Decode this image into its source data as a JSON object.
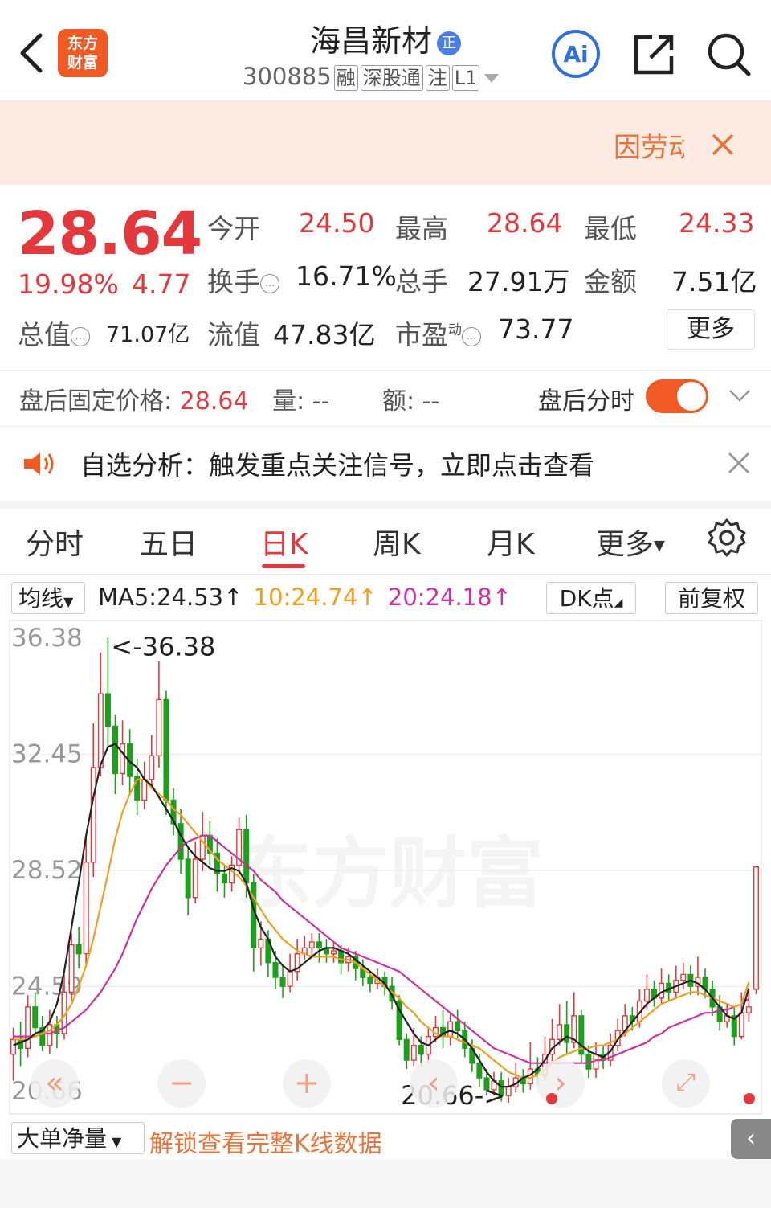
{
  "header": {
    "logo_text": "东方\n财富",
    "stock_name": "海昌新材",
    "name_badge": "正",
    "stock_code": "300885",
    "tags": [
      "融",
      "深股通",
      "注",
      "L1"
    ],
    "ai_label": "Ai"
  },
  "banner": {
    "text": "因劳动"
  },
  "quote": {
    "price": "28.64",
    "change_pct": "19.98%",
    "change": "4.77",
    "fields": [
      {
        "label": "今开",
        "value": "24.50"
      },
      {
        "label": "最高",
        "value": "28.64"
      },
      {
        "label": "最低",
        "value": "24.33"
      },
      {
        "label": "换手",
        "value": "16.71%"
      },
      {
        "label": "总手",
        "value": "27.91万"
      },
      {
        "label": "金额",
        "value": "7.51亿"
      },
      {
        "label": "总值",
        "value": "71.07亿"
      },
      {
        "label": "流值",
        "value": "47.83亿"
      },
      {
        "label": "市盈",
        "value": "73.77",
        "sup": "动"
      }
    ],
    "more_label": "更多"
  },
  "after_hours": {
    "price_label": "盘后固定价格:",
    "price_value": "28.64",
    "vol_label": "量:",
    "vol_value": "--",
    "amt_label": "额:",
    "amt_value": "--",
    "toggle_label": "盘后分时",
    "toggle_on": true
  },
  "alert": {
    "text": "自选分析：触发重点关注信号，立即点击查看"
  },
  "tabs": [
    "分时",
    "五日",
    "日K",
    "周K",
    "月K",
    "更多"
  ],
  "active_tab": "日K",
  "ma": {
    "select_label": "均线",
    "ma5": "MA5:24.53",
    "ma10": "10:24.74",
    "ma20": "20:24.18",
    "dk_label": "DK点",
    "fq_label": "前复权",
    "colors": {
      "ma5": "#222222",
      "ma10": "#f0a020",
      "ma20": "#d030a0",
      "up": "#e4393c",
      "down": "#1aa01a"
    }
  },
  "chart_data": {
    "type": "candlestick",
    "y_ticks": [
      "36.38",
      "32.45",
      "28.52",
      "24.59",
      "20.66"
    ],
    "ylim": [
      20.66,
      36.38
    ],
    "high_marker": "<-36.38",
    "low_marker": "20.66->",
    "watermark": "东方财富",
    "candles": [
      [
        22.3,
        22.8,
        21.4,
        23.2
      ],
      [
        22.8,
        22.5,
        21.9,
        23.4
      ],
      [
        22.5,
        23.9,
        22.2,
        24.3
      ],
      [
        23.9,
        23.2,
        22.9,
        24.4
      ],
      [
        23.2,
        22.6,
        22.4,
        23.6
      ],
      [
        22.6,
        23.3,
        22.3,
        23.8
      ],
      [
        23.3,
        23.0,
        22.5,
        23.6
      ],
      [
        23.0,
        24.4,
        22.8,
        25.0
      ],
      [
        24.4,
        26.0,
        24.1,
        26.4
      ],
      [
        26.0,
        25.7,
        25.2,
        26.6
      ],
      [
        25.7,
        28.8,
        25.3,
        29.7
      ],
      [
        28.8,
        32.0,
        28.3,
        33.5
      ],
      [
        32.0,
        34.5,
        31.7,
        35.9
      ],
      [
        34.5,
        33.4,
        32.7,
        36.4
      ],
      [
        33.4,
        31.8,
        31.1,
        33.8
      ],
      [
        31.8,
        32.8,
        31.4,
        33.6
      ],
      [
        32.8,
        31.7,
        31.1,
        33.3
      ],
      [
        31.7,
        30.9,
        30.4,
        32.3
      ],
      [
        30.9,
        31.6,
        30.6,
        32.2
      ],
      [
        31.6,
        32.4,
        31.4,
        33.1
      ],
      [
        32.4,
        34.3,
        32.0,
        35.6
      ],
      [
        34.3,
        30.9,
        30.4,
        34.6
      ],
      [
        30.9,
        30.1,
        29.7,
        31.3
      ],
      [
        30.1,
        28.9,
        28.4,
        30.6
      ],
      [
        28.9,
        27.6,
        27.0,
        29.3
      ],
      [
        27.6,
        28.9,
        27.4,
        29.5
      ],
      [
        28.9,
        29.7,
        28.5,
        30.5
      ],
      [
        29.7,
        29.1,
        28.7,
        30.2
      ],
      [
        29.1,
        28.4,
        27.8,
        29.6
      ],
      [
        28.4,
        28.1,
        27.6,
        28.7
      ],
      [
        28.1,
        28.7,
        27.8,
        29.0
      ],
      [
        28.7,
        29.9,
        28.4,
        30.3
      ],
      [
        29.9,
        28.1,
        27.6,
        30.4
      ],
      [
        28.1,
        25.9,
        25.1,
        28.4
      ],
      [
        25.9,
        26.2,
        25.3,
        26.8
      ],
      [
        26.2,
        25.4,
        24.9,
        26.5
      ],
      [
        25.4,
        24.9,
        24.5,
        25.8
      ],
      [
        24.9,
        24.6,
        24.2,
        25.3
      ],
      [
        24.6,
        25.1,
        24.4,
        25.7
      ],
      [
        25.1,
        25.7,
        24.8,
        26.2
      ],
      [
        25.7,
        25.9,
        25.5,
        26.3
      ],
      [
        25.9,
        26.1,
        25.6,
        26.4
      ],
      [
        26.1,
        25.9,
        25.4,
        26.4
      ],
      [
        25.9,
        25.7,
        25.4,
        26.2
      ],
      [
        25.7,
        25.8,
        25.4,
        26.1
      ],
      [
        25.8,
        25.4,
        25.0,
        26.0
      ],
      [
        25.4,
        25.6,
        25.1,
        25.9
      ],
      [
        25.6,
        25.2,
        24.8,
        25.8
      ],
      [
        25.2,
        24.9,
        24.6,
        25.5
      ],
      [
        24.9,
        24.7,
        24.4,
        25.1
      ],
      [
        24.7,
        24.9,
        24.5,
        25.2
      ],
      [
        24.9,
        24.6,
        24.3,
        25.1
      ],
      [
        24.6,
        24.1,
        23.8,
        24.9
      ],
      [
        24.1,
        22.8,
        22.6,
        24.3
      ],
      [
        22.8,
        22.1,
        21.8,
        23.0
      ],
      [
        22.1,
        22.6,
        21.9,
        23.2
      ],
      [
        22.6,
        22.3,
        21.9,
        22.9
      ],
      [
        22.3,
        22.9,
        22.0,
        23.2
      ],
      [
        22.9,
        23.2,
        22.7,
        23.6
      ],
      [
        23.2,
        22.9,
        22.5,
        23.8
      ],
      [
        22.9,
        23.4,
        22.6,
        23.7
      ],
      [
        23.4,
        23.1,
        22.8,
        23.8
      ],
      [
        23.1,
        22.5,
        22.2,
        23.4
      ],
      [
        22.5,
        22.0,
        21.7,
        22.8
      ],
      [
        22.0,
        21.5,
        21.2,
        22.3
      ],
      [
        21.5,
        21.1,
        20.9,
        21.8
      ],
      [
        21.1,
        21.4,
        20.9,
        21.7
      ],
      [
        21.4,
        20.9,
        20.7,
        21.7
      ],
      [
        20.9,
        21.2,
        20.66,
        21.5
      ],
      [
        21.2,
        21.5,
        21.0,
        22.0
      ],
      [
        21.5,
        21.3,
        21.0,
        21.8
      ],
      [
        21.3,
        21.8,
        21.1,
        22.7
      ],
      [
        21.8,
        21.6,
        21.3,
        22.2
      ],
      [
        21.6,
        22.3,
        21.4,
        22.9
      ],
      [
        22.3,
        22.8,
        22.0,
        23.5
      ],
      [
        22.8,
        23.3,
        22.6,
        24.0
      ],
      [
        23.3,
        22.7,
        22.3,
        24.1
      ],
      [
        22.7,
        23.6,
        22.5,
        24.4
      ],
      [
        23.6,
        22.3,
        22.0,
        23.8
      ],
      [
        22.3,
        21.8,
        21.5,
        22.6
      ],
      [
        21.8,
        22.3,
        21.5,
        22.7
      ],
      [
        22.3,
        22.1,
        21.8,
        22.6
      ],
      [
        22.1,
        22.6,
        21.9,
        23.0
      ],
      [
        22.6,
        23.1,
        22.4,
        23.5
      ],
      [
        23.1,
        23.6,
        22.9,
        24.0
      ],
      [
        23.6,
        23.4,
        23.1,
        23.9
      ],
      [
        23.4,
        24.1,
        23.2,
        24.5
      ],
      [
        24.1,
        24.5,
        23.8,
        25.0
      ],
      [
        24.5,
        24.2,
        23.9,
        24.8
      ],
      [
        24.2,
        24.7,
        24.0,
        25.2
      ],
      [
        24.7,
        24.4,
        24.1,
        25.0
      ],
      [
        24.4,
        24.8,
        24.2,
        25.3
      ],
      [
        24.8,
        25.0,
        24.5,
        25.4
      ],
      [
        25.0,
        24.6,
        24.3,
        25.3
      ],
      [
        24.6,
        24.9,
        24.3,
        25.6
      ],
      [
        24.9,
        24.5,
        24.2,
        25.2
      ],
      [
        24.5,
        23.9,
        23.6,
        24.8
      ],
      [
        23.9,
        23.4,
        23.1,
        24.3
      ],
      [
        23.4,
        23.6,
        23.2,
        24.0
      ],
      [
        23.6,
        22.9,
        22.6,
        23.9
      ],
      [
        22.9,
        23.7,
        22.8,
        24.4
      ],
      [
        23.7,
        23.9,
        23.4,
        24.5
      ],
      [
        24.5,
        28.64,
        24.33,
        28.64
      ]
    ],
    "ma5": [
      22.6,
      22.7,
      22.8,
      23.0,
      23.1,
      23.4,
      24.0,
      25.1,
      26.6,
      28.1,
      29.7,
      31.0,
      32.1,
      32.7,
      32.8,
      32.5,
      32.2,
      32.0,
      31.6,
      31.4,
      31.0,
      30.6,
      30.2,
      29.7,
      29.3,
      29.0,
      28.8,
      28.6,
      28.5,
      28.5,
      28.6,
      28.5,
      28.1,
      27.2,
      26.6,
      26.2,
      25.6,
      25.3,
      25.1,
      25.2,
      25.4,
      25.6,
      25.8,
      25.9,
      25.9,
      25.8,
      25.7,
      25.5,
      25.3,
      25.1,
      24.9,
      24.7,
      24.3,
      23.8,
      23.4,
      23.0,
      22.7,
      22.6,
      22.8,
      23.0,
      23.1,
      23.0,
      22.8,
      22.5,
      22.1,
      21.7,
      21.4,
      21.2,
      21.2,
      21.3,
      21.5,
      21.6,
      21.8,
      22.1,
      22.5,
      22.7,
      22.9,
      22.8,
      22.6,
      22.4,
      22.3,
      22.2,
      22.4,
      22.8,
      23.1,
      23.4,
      23.7,
      24.0,
      24.2,
      24.4,
      24.5,
      24.6,
      24.7,
      24.8,
      24.7,
      24.5,
      24.2,
      23.9,
      23.6,
      23.5,
      23.7,
      24.53
    ],
    "ma10": [
      22.8,
      22.8,
      22.8,
      22.9,
      23.0,
      23.1,
      23.3,
      23.6,
      24.0,
      24.6,
      25.3,
      26.2,
      27.3,
      28.4,
      29.6,
      30.5,
      31.1,
      31.6,
      31.6,
      31.3,
      31.1,
      30.9,
      30.6,
      30.4,
      30.1,
      29.8,
      29.5,
      29.2,
      28.9,
      28.7,
      28.5,
      28.3,
      28.0,
      27.6,
      27.2,
      26.8,
      26.5,
      26.2,
      26.0,
      25.8,
      25.7,
      25.6,
      25.6,
      25.6,
      25.6,
      25.5,
      25.5,
      25.4,
      25.2,
      25.0,
      24.8,
      24.6,
      24.4,
      24.2,
      23.9,
      23.7,
      23.4,
      23.2,
      23.0,
      22.9,
      22.9,
      22.8,
      22.7,
      22.6,
      22.5,
      22.3,
      22.1,
      21.9,
      21.7,
      21.6,
      21.5,
      21.5,
      21.6,
      21.8,
      22.0,
      22.2,
      22.3,
      22.4,
      22.5,
      22.5,
      22.6,
      22.6,
      22.7,
      22.8,
      23.0,
      23.2,
      23.4,
      23.6,
      23.8,
      24.0,
      24.1,
      24.2,
      24.3,
      24.4,
      24.4,
      24.3,
      24.2,
      24.1,
      24.0,
      23.9,
      24.0,
      24.74
    ],
    "ma20": [
      22.9,
      22.9,
      22.9,
      22.9,
      23.0,
      23.0,
      23.1,
      23.2,
      23.4,
      23.6,
      23.8,
      24.1,
      24.4,
      24.8,
      25.2,
      25.7,
      26.3,
      26.9,
      27.4,
      27.9,
      28.3,
      28.7,
      29.0,
      29.3,
      29.5,
      29.6,
      29.7,
      29.7,
      29.5,
      29.3,
      29.1,
      28.9,
      28.7,
      28.5,
      28.2,
      28.0,
      27.8,
      27.5,
      27.3,
      27.1,
      26.9,
      26.7,
      26.5,
      26.3,
      26.1,
      25.9,
      25.8,
      25.7,
      25.6,
      25.5,
      25.4,
      25.3,
      25.2,
      25.1,
      24.9,
      24.7,
      24.5,
      24.3,
      24.1,
      23.9,
      23.7,
      23.5,
      23.3,
      23.1,
      22.9,
      22.7,
      22.5,
      22.4,
      22.3,
      22.2,
      22.1,
      22.0,
      22.0,
      22.0,
      22.0,
      22.0,
      22.0,
      22.0,
      22.0,
      22.0,
      22.1,
      22.1,
      22.2,
      22.3,
      22.4,
      22.5,
      22.6,
      22.7,
      22.9,
      23.0,
      23.2,
      23.3,
      23.4,
      23.5,
      23.6,
      23.7,
      23.7,
      23.8,
      23.8,
      23.9,
      24.0,
      24.18
    ]
  },
  "bottom": {
    "flow_label": "大单净量",
    "unlock_text": "解锁查看完整K线数据",
    "collapse_label": "‹"
  }
}
